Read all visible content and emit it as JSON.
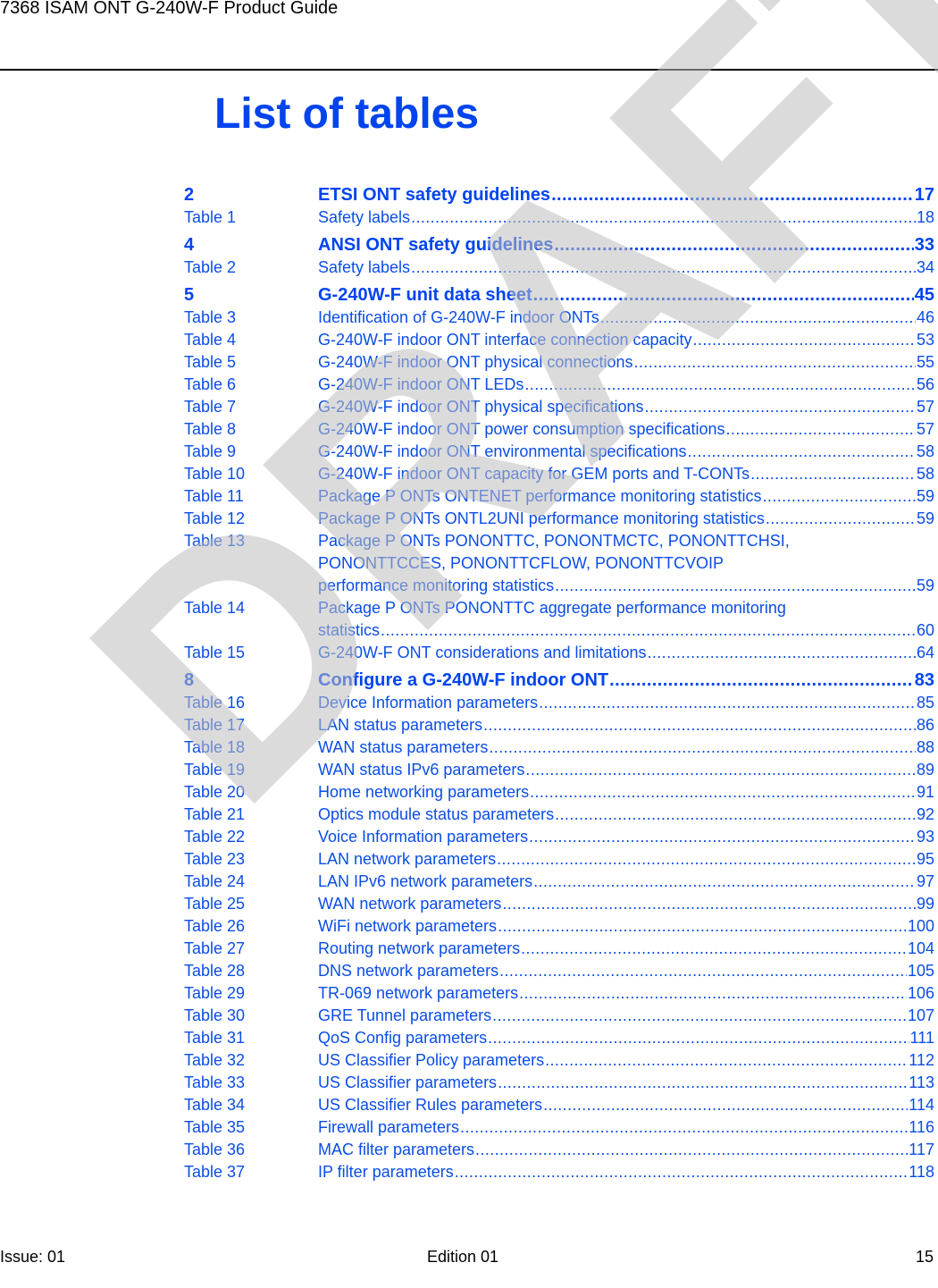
{
  "header": {
    "title": "7368 ISAM ONT G-240W-F Product Guide"
  },
  "page_title": "List of tables",
  "watermark": "DRAFT",
  "toc": [
    {
      "type": "chapter",
      "num": "2",
      "label": "ETSI ONT safety guidelines",
      "page": "17"
    },
    {
      "type": "entry",
      "num": "Table 1",
      "label": "Safety labels",
      "page": "18"
    },
    {
      "type": "chapter",
      "num": "4",
      "label": "ANSI ONT safety guidelines",
      "page": "33"
    },
    {
      "type": "entry",
      "num": "Table 2",
      "label": "Safety labels",
      "page": "34"
    },
    {
      "type": "chapter",
      "num": "5",
      "label": "G-240W-F unit data sheet",
      "page": "45"
    },
    {
      "type": "entry",
      "num": "Table 3",
      "label": "Identification of G-240W-F indoor ONTs",
      "page": "46"
    },
    {
      "type": "entry",
      "num": "Table 4",
      "label": "G-240W-F indoor ONT interface connection capacity",
      "page": "53"
    },
    {
      "type": "entry",
      "num": "Table 5",
      "label": "G-240W-F indoor ONT physical connections",
      "page": "55"
    },
    {
      "type": "entry",
      "num": "Table 6",
      "label": "G-240W-F indoor ONT LEDs",
      "page": "56"
    },
    {
      "type": "entry",
      "num": "Table 7",
      "label": "G-240W-F indoor ONT physical specifications",
      "page": "57"
    },
    {
      "type": "entry",
      "num": "Table 8",
      "label": "G-240W-F indoor ONT power consumption specifications",
      "page": "57"
    },
    {
      "type": "entry",
      "num": "Table 9",
      "label": "G-240W-F indoor ONT environmental specifications",
      "page": "58"
    },
    {
      "type": "entry",
      "num": "Table 10",
      "label": "G-240W-F indoor ONT capacity for GEM ports and T-CONTs",
      "page": "58"
    },
    {
      "type": "entry",
      "num": "Table 11",
      "label": "Package P ONTs ONTENET performance monitoring statistics",
      "page": "59"
    },
    {
      "type": "entry",
      "num": "Table 12",
      "label": "Package P ONTs ONTL2UNI performance monitoring statistics",
      "page": "59"
    },
    {
      "type": "multi",
      "num": "Table 13",
      "lines": [
        "Package P ONTs PONONTTC, PONONTMCTC, PONONTTCHSI,",
        "PONONTTCCES, PONONTTCFLOW, PONONTTCVOIP"
      ],
      "last": "performance monitoring statistics",
      "page": "59"
    },
    {
      "type": "multi",
      "num": "Table 14",
      "lines": [
        "Package P ONTs PONONTTC aggregate performance monitoring"
      ],
      "last": "statistics",
      "page": "60"
    },
    {
      "type": "entry",
      "num": "Table 15",
      "label": "G-240W-F ONT considerations and limitations",
      "page": "64"
    },
    {
      "type": "chapter",
      "num": "8",
      "label": "Configure a G-240W-F indoor ONT",
      "page": "83"
    },
    {
      "type": "entry",
      "num": "Table 16",
      "label": "Device Information parameters",
      "page": "85"
    },
    {
      "type": "entry",
      "num": "Table 17",
      "label": "LAN status parameters",
      "page": "86"
    },
    {
      "type": "entry",
      "num": "Table 18",
      "label": "WAN status parameters",
      "page": "88"
    },
    {
      "type": "entry",
      "num": "Table 19",
      "label": "WAN status IPv6 parameters",
      "page": "89"
    },
    {
      "type": "entry",
      "num": "Table 20",
      "label": "Home networking parameters",
      "page": "91"
    },
    {
      "type": "entry",
      "num": "Table 21",
      "label": "Optics module status parameters",
      "page": "92"
    },
    {
      "type": "entry",
      "num": "Table 22",
      "label": "Voice Information parameters",
      "page": "93"
    },
    {
      "type": "entry",
      "num": "Table 23",
      "label": "LAN network parameters",
      "page": "95"
    },
    {
      "type": "entry",
      "num": "Table 24",
      "label": "LAN IPv6 network parameters",
      "page": "97"
    },
    {
      "type": "entry",
      "num": "Table 25",
      "label": "WAN network parameters",
      "page": "99"
    },
    {
      "type": "entry",
      "num": "Table 26",
      "label": "WiFi network parameters",
      "page": "100"
    },
    {
      "type": "entry",
      "num": "Table 27",
      "label": "Routing network parameters",
      "page": "104"
    },
    {
      "type": "entry",
      "num": "Table 28",
      "label": "DNS network parameters",
      "page": "105"
    },
    {
      "type": "entry",
      "num": "Table 29",
      "label": "TR-069 network parameters",
      "page": "106"
    },
    {
      "type": "entry",
      "num": "Table 30",
      "label": "GRE Tunnel parameters",
      "page": "107"
    },
    {
      "type": "entry",
      "num": "Table 31",
      "label": "QoS Config parameters",
      "page": "111"
    },
    {
      "type": "entry",
      "num": "Table 32",
      "label": "US Classifier Policy parameters",
      "page": "112"
    },
    {
      "type": "entry",
      "num": "Table 33",
      "label": "US Classifier parameters",
      "page": "113"
    },
    {
      "type": "entry",
      "num": "Table 34",
      "label": "US Classifier Rules parameters",
      "page": "114"
    },
    {
      "type": "entry",
      "num": "Table 35",
      "label": "Firewall parameters",
      "page": "116"
    },
    {
      "type": "entry",
      "num": "Table 36",
      "label": "MAC filter parameters",
      "page": "117"
    },
    {
      "type": "entry",
      "num": "Table 37",
      "label": "IP filter parameters",
      "page": "118"
    }
  ],
  "footer": {
    "issue": "Issue: 01",
    "edition": "Edition 01",
    "page_number": "15"
  }
}
